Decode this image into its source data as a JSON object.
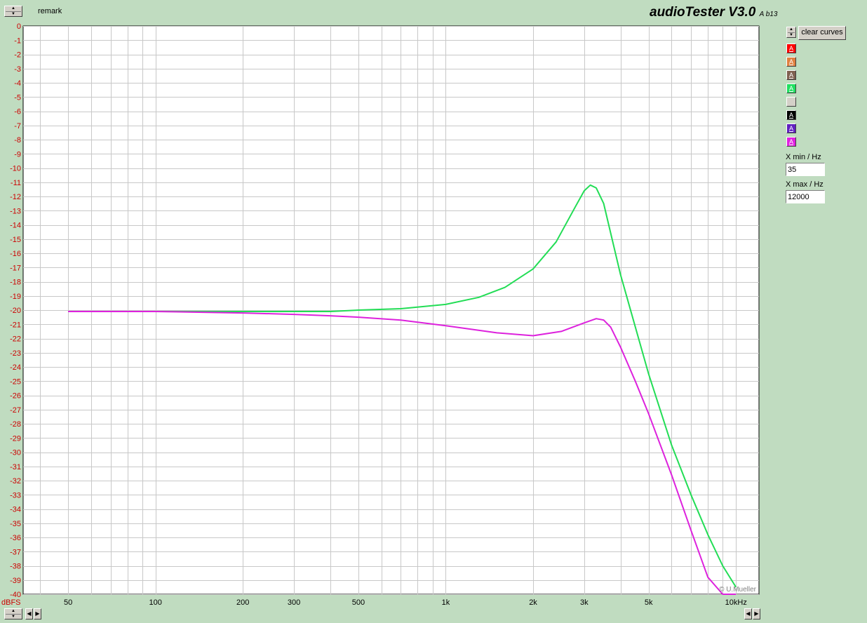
{
  "app": {
    "title": "audioTester V3.0",
    "version_note": "A b13"
  },
  "toolbar": {
    "remark_label": "remark",
    "clear_curves_label": "clear curves"
  },
  "curve_swatches": [
    {
      "color": "#ff0000",
      "label": "A"
    },
    {
      "color": "#e08040",
      "label": "A"
    },
    {
      "color": "#806050",
      "label": "A"
    },
    {
      "color": "#20e060",
      "label": "A"
    },
    {
      "color": "#d4d0c8",
      "label": ""
    },
    {
      "color": "#000000",
      "label": "A"
    },
    {
      "color": "#6020c0",
      "label": "A"
    },
    {
      "color": "#e020e0",
      "label": "A"
    }
  ],
  "settings": {
    "xmin_label": "X min / Hz",
    "xmin_value": "35",
    "xmax_label": "X max / Hz",
    "xmax_value": "12000"
  },
  "chart_data": {
    "type": "line",
    "title": "",
    "xlabel": "",
    "ylabel": "",
    "y_unit_label": "dBFS",
    "x_scale": "log",
    "xlim": [
      35,
      12000
    ],
    "ylim": [
      -40,
      0
    ],
    "grid": true,
    "x_tick_labels": [
      {
        "value": 50,
        "label": "50"
      },
      {
        "value": 100,
        "label": "100"
      },
      {
        "value": 200,
        "label": "200"
      },
      {
        "value": 300,
        "label": "300"
      },
      {
        "value": 500,
        "label": "500"
      },
      {
        "value": 1000,
        "label": "1k"
      },
      {
        "value": 2000,
        "label": "2k"
      },
      {
        "value": 3000,
        "label": "3k"
      },
      {
        "value": 5000,
        "label": "5k"
      },
      {
        "value": 10000,
        "label": "10kHz"
      }
    ],
    "y_ticks": [
      0,
      -1,
      -2,
      -3,
      -4,
      -5,
      -6,
      -7,
      -8,
      -9,
      -10,
      -11,
      -12,
      -13,
      -14,
      -15,
      -16,
      -17,
      -18,
      -19,
      -20,
      -21,
      -22,
      -23,
      -24,
      -25,
      -26,
      -27,
      -28,
      -29,
      -30,
      -31,
      -32,
      -33,
      -34,
      -35,
      -36,
      -37,
      -38,
      -39,
      -40
    ],
    "series": [
      {
        "color": "#22dd55",
        "x": [
          50,
          100,
          200,
          300,
          400,
          500,
          700,
          1000,
          1300,
          1600,
          2000,
          2400,
          2800,
          3000,
          3150,
          3300,
          3500,
          4000,
          5000,
          6000,
          7000,
          8000,
          9000,
          10000
        ],
        "y": [
          -20.1,
          -20.1,
          -20.1,
          -20.1,
          -20.1,
          -20.0,
          -19.9,
          -19.6,
          -19.1,
          -18.4,
          -17.1,
          -15.2,
          -12.7,
          -11.6,
          -11.2,
          -11.4,
          -12.5,
          -17.5,
          -24.5,
          -29.5,
          -33.0,
          -35.8,
          -38.0,
          -39.5
        ]
      },
      {
        "color": "#dd22dd",
        "x": [
          50,
          100,
          200,
          300,
          400,
          500,
          700,
          1000,
          1500,
          2000,
          2500,
          3000,
          3300,
          3500,
          3700,
          4000,
          4500,
          5000,
          6000,
          7000,
          8000,
          9000,
          10000
        ],
        "y": [
          -20.1,
          -20.1,
          -20.2,
          -20.3,
          -20.4,
          -20.5,
          -20.7,
          -21.1,
          -21.6,
          -21.8,
          -21.5,
          -20.9,
          -20.6,
          -20.7,
          -21.2,
          -22.6,
          -25.0,
          -27.3,
          -31.6,
          -35.5,
          -38.8,
          -40.0,
          -40.0
        ]
      }
    ]
  },
  "watermark": "© U.Mueller"
}
